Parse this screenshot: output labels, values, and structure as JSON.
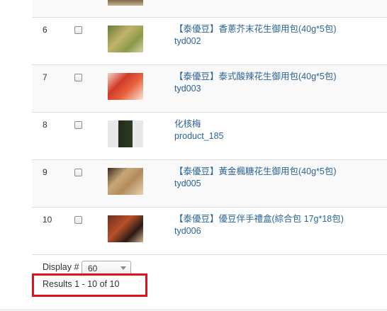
{
  "products": [
    {
      "number": "6",
      "name": "【泰優豆】香蔥芥末花生御用包(40g*5包)",
      "sku": "tyd002",
      "thumbnail": "product-thumbnail"
    },
    {
      "number": "7",
      "name": "【泰優豆】泰式酸辣花生御用包(40g*5包)",
      "sku": "tyd003",
      "thumbnail": "product-thumbnail"
    },
    {
      "number": "8",
      "name": "化核梅",
      "sku": "product_185",
      "thumbnail": "product-thumbnail"
    },
    {
      "number": "9",
      "name": "【泰優豆】黃金楓糖花生御用包(40g*5包)",
      "sku": "tyd005",
      "thumbnail": "product-thumbnail"
    },
    {
      "number": "10",
      "name": "【泰優豆】優豆伴手禮盒(綜合包 17g*18包)",
      "sku": "tyd006",
      "thumbnail": "product-thumbnail"
    }
  ],
  "footer": {
    "display_label": "Display #",
    "display_value": "60",
    "results_text": "Results 1 - 10 of 10"
  },
  "colors": {
    "link": "#2a6496",
    "highlight": "#e0101e",
    "row_stripe": "#f9f9f9",
    "border": "#dddddd"
  }
}
